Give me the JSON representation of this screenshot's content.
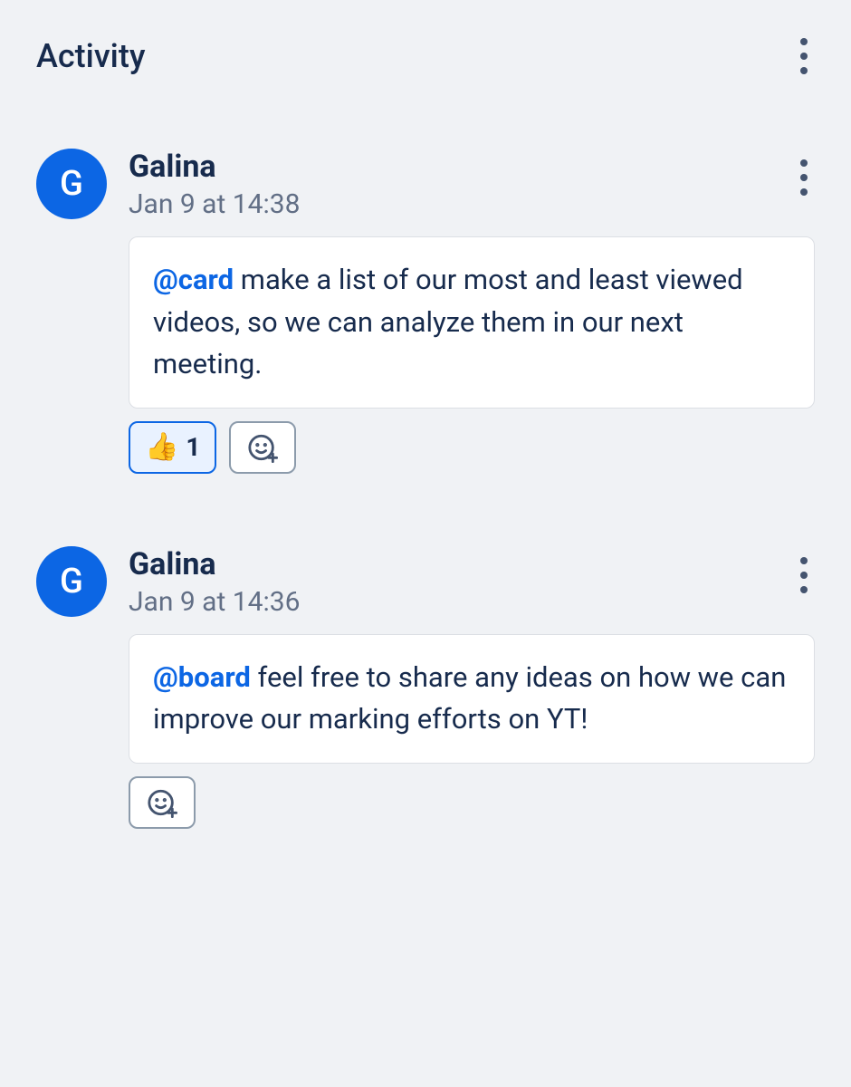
{
  "section": {
    "title": "Activity"
  },
  "comments": [
    {
      "avatar_initial": "G",
      "author": "Galina",
      "timestamp": "Jan 9 at 14:38",
      "mention": "@card",
      "body": " make a list of our most and least viewed videos, so we can analyze them in our next meeting.",
      "reactions": [
        {
          "emoji": "👍",
          "count": "1"
        }
      ]
    },
    {
      "avatar_initial": "G",
      "author": "Galina",
      "timestamp": "Jan 9 at 14:36",
      "mention": "@board",
      "body": " feel free to share any ideas on how we can improve our marking efforts on YT!",
      "reactions": []
    }
  ]
}
